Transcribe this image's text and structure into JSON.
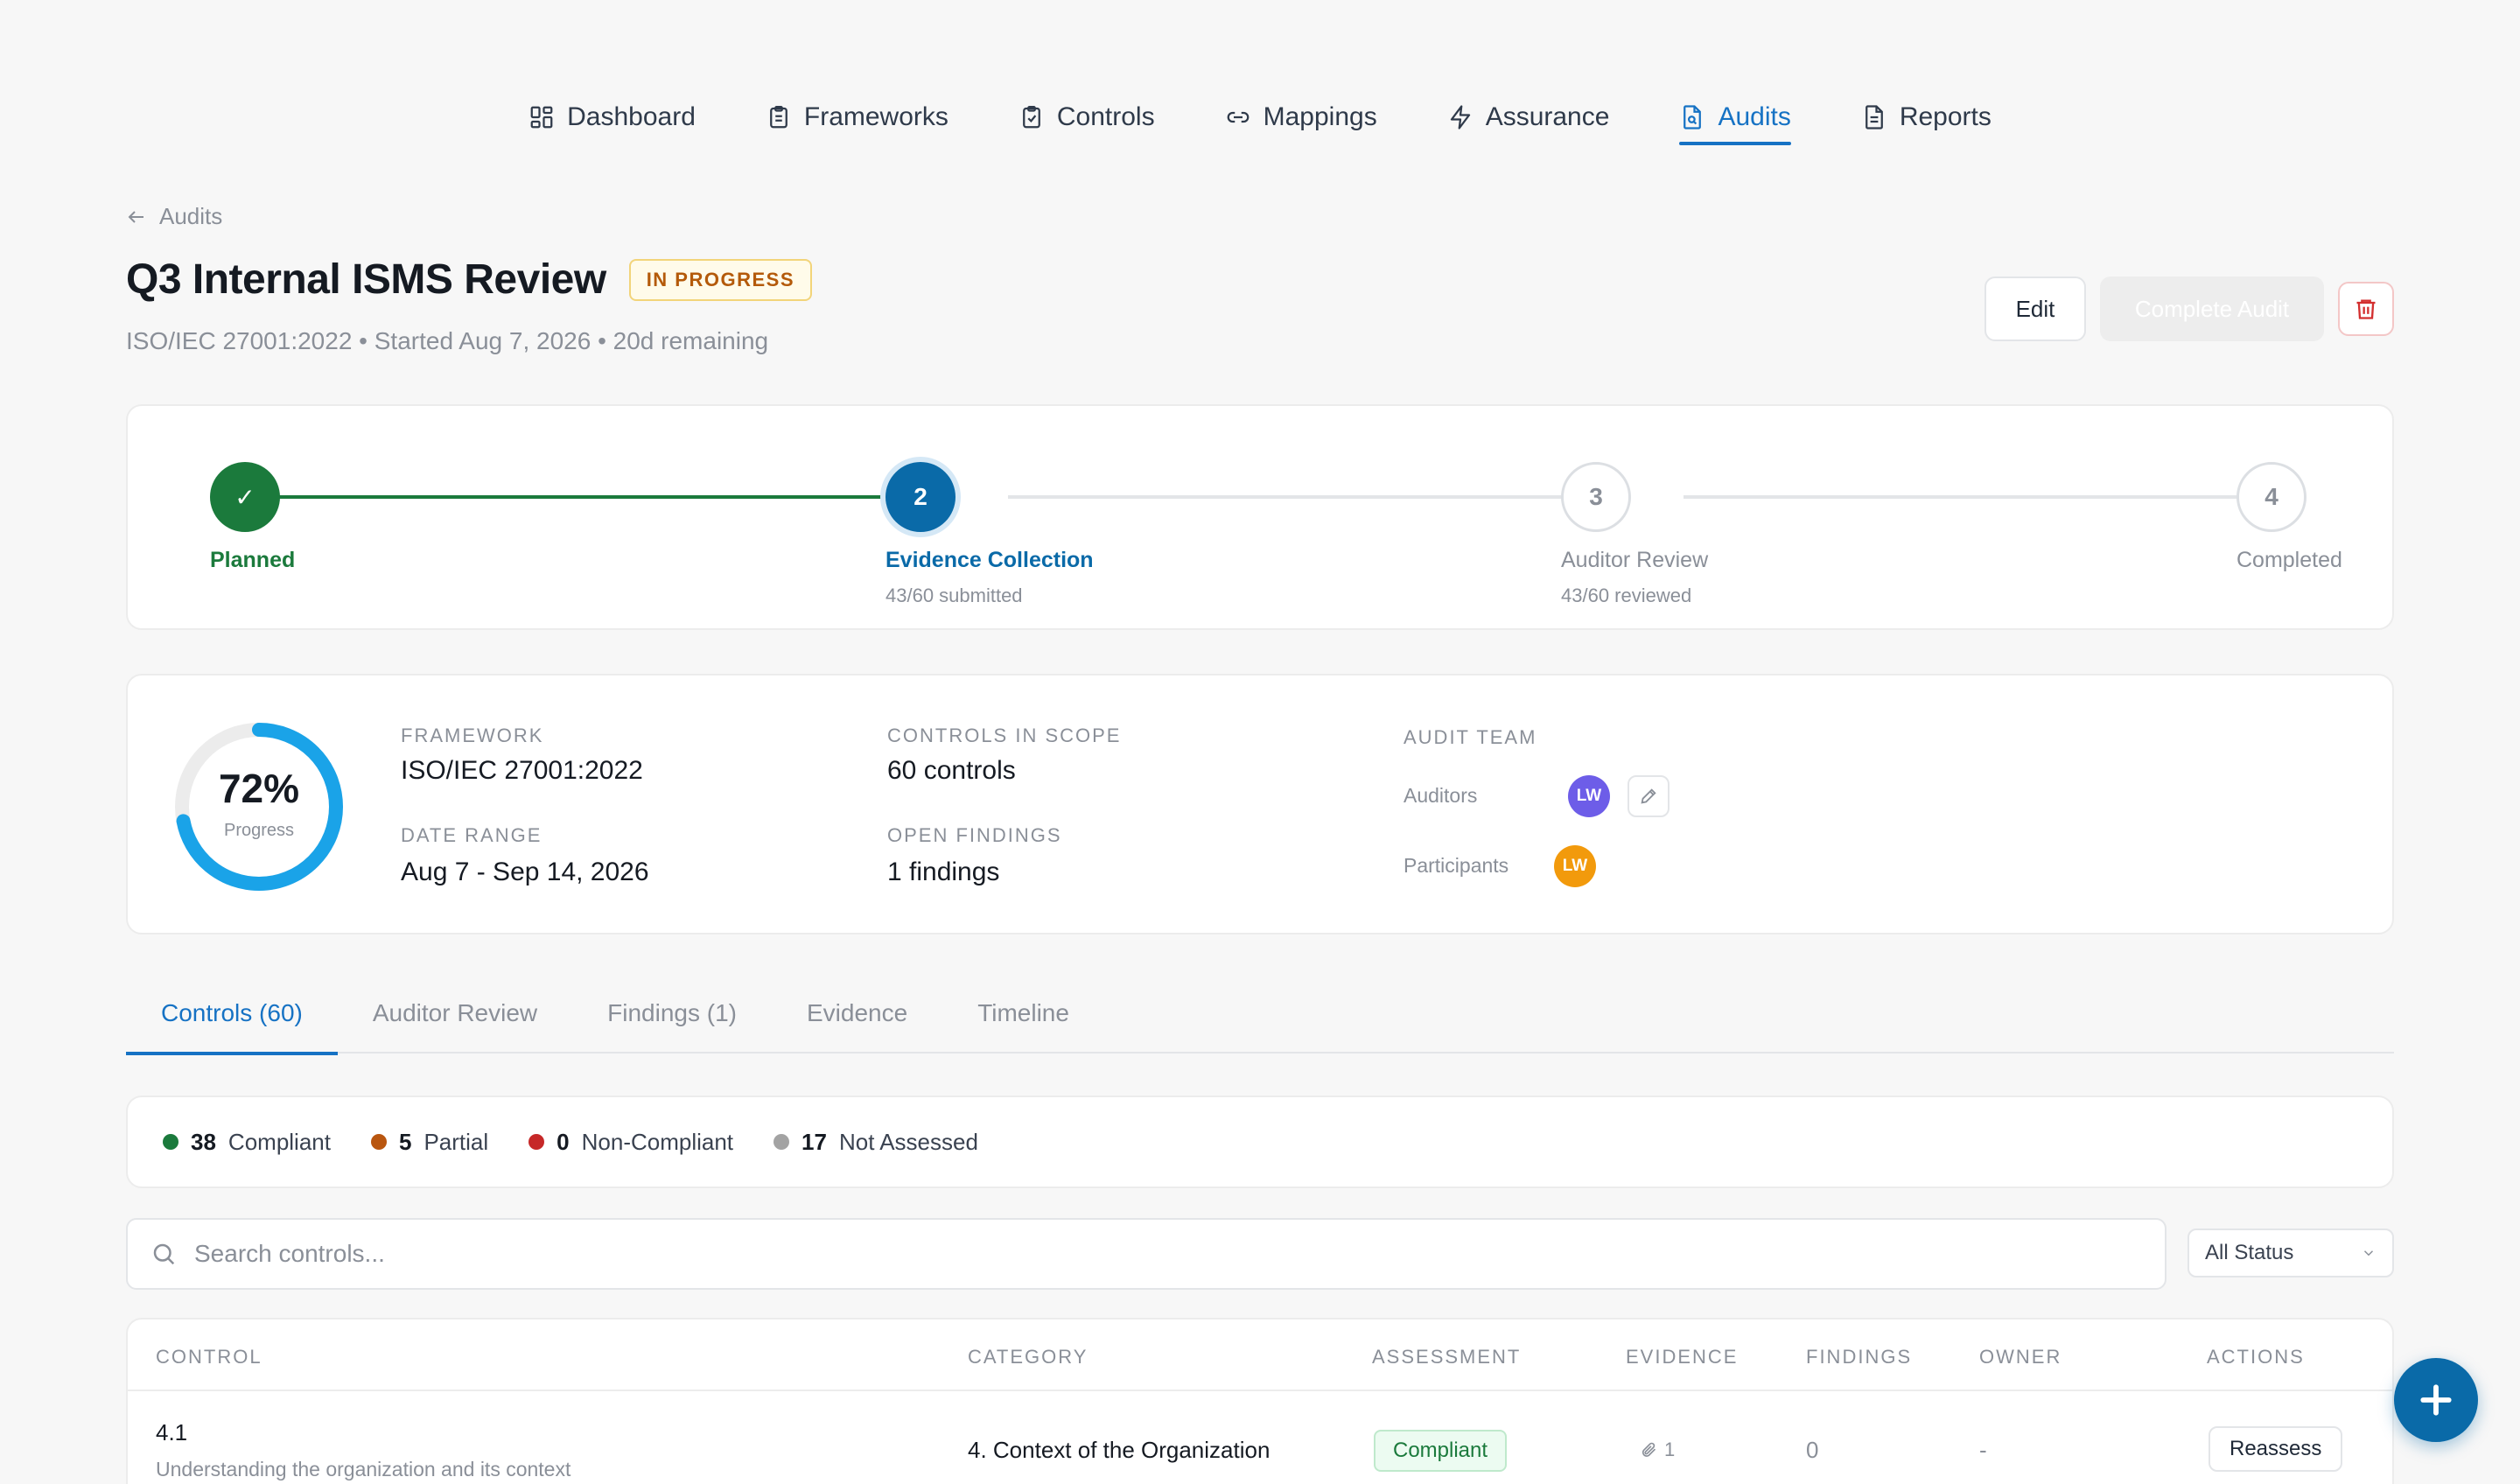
{
  "nav": {
    "items": [
      {
        "label": "Dashboard",
        "icon": "dashboard-icon",
        "active": false
      },
      {
        "label": "Frameworks",
        "icon": "clipboard-icon",
        "active": false
      },
      {
        "label": "Controls",
        "icon": "clipboard-check-icon",
        "active": false
      },
      {
        "label": "Mappings",
        "icon": "link-icon",
        "active": false
      },
      {
        "label": "Assurance",
        "icon": "bolt-icon",
        "active": false
      },
      {
        "label": "Audits",
        "icon": "file-search-icon",
        "active": true
      },
      {
        "label": "Reports",
        "icon": "file-text-icon",
        "active": false
      }
    ]
  },
  "header": {
    "back_label": "Audits",
    "title": "Q3 Internal ISMS Review",
    "status_badge": "IN PROGRESS",
    "subtitle": "ISO/IEC 27001:2022 • Started Aug 7, 2026 • 20d remaining",
    "edit_label": "Edit",
    "complete_label": "Complete Audit"
  },
  "stepper": {
    "steps": [
      {
        "num": "✓",
        "label": "Planned",
        "sub": "",
        "state": "done"
      },
      {
        "num": "2",
        "label": "Evidence Collection",
        "sub": "43/60 submitted",
        "state": "current"
      },
      {
        "num": "3",
        "label": "Auditor Review",
        "sub": "43/60 reviewed",
        "state": "pending"
      },
      {
        "num": "4",
        "label": "Completed",
        "sub": "",
        "state": "pending"
      }
    ]
  },
  "info": {
    "progress_pct_value": 72,
    "progress_pct": "72%",
    "progress_label": "Progress",
    "framework_label": "FRAMEWORK",
    "framework_value": "ISO/IEC 27001:2022",
    "date_label": "DATE RANGE",
    "date_value": "Aug 7 - Sep 14, 2026",
    "controls_label": "CONTROLS IN SCOPE",
    "controls_value": "60 controls",
    "findings_label": "OPEN FINDINGS",
    "findings_value": "1 findings",
    "team_label": "AUDIT TEAM",
    "auditors_label": "Auditors",
    "auditor_initials": "LW",
    "participants_label": "Participants",
    "participant_initials": "LW"
  },
  "tabs": [
    {
      "label": "Controls (60)",
      "active": true
    },
    {
      "label": "Auditor Review",
      "active": false
    },
    {
      "label": "Findings (1)",
      "active": false
    },
    {
      "label": "Evidence",
      "active": false
    },
    {
      "label": "Timeline",
      "active": false
    }
  ],
  "summary": [
    {
      "count": "38",
      "label": "Compliant",
      "color": "#1b7a3c"
    },
    {
      "count": "5",
      "label": "Partial",
      "color": "#b9560f"
    },
    {
      "count": "0",
      "label": "Non-Compliant",
      "color": "#c62828"
    },
    {
      "count": "17",
      "label": "Not Assessed",
      "color": "#a3a3a3"
    }
  ],
  "search": {
    "placeholder": "Search controls..."
  },
  "status_filter": {
    "selected": "All Status"
  },
  "table": {
    "headers": {
      "control": "CONTROL",
      "category": "CATEGORY",
      "assessment": "ASSESSMENT",
      "evidence": "EVIDENCE",
      "findings": "FINDINGS",
      "owner": "OWNER",
      "actions": "ACTIONS"
    },
    "rows": [
      {
        "id": "4.1",
        "name": "Understanding the organization and its context",
        "category": "4. Context of the Organization",
        "assessment": "Compliant",
        "evidence": "1",
        "findings": "0",
        "owner": "-",
        "action": "Reassess"
      }
    ]
  },
  "colors": {
    "accent": "#1672c4",
    "done": "#1b7a3c",
    "current": "#0a6aa8",
    "ring": "#1aa3e8",
    "auditor_avatar": "#6d5de8",
    "participant_avatar": "#f29a0c"
  }
}
